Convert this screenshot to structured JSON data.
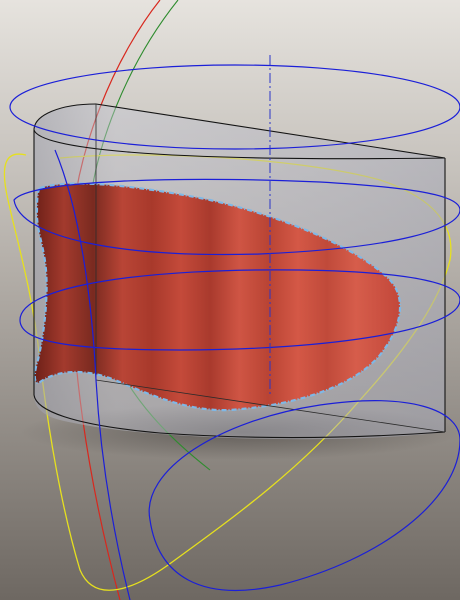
{
  "scene": {
    "background_top": "#e6e3de",
    "background_bottom": "#6e6862"
  },
  "colors": {
    "surface_fill": "#c9503f",
    "surface_dark": "#8f2f24",
    "surface_edge_outline": "#7fb8e6",
    "solid_edge": "#141414",
    "solid_fill": "#b9bcc8",
    "centerline": "#2a35c8",
    "curve_blue": "#1b1fd8",
    "curve_yellow": "#e6e01e",
    "curve_red": "#d8281e",
    "curve_green": "#2e8c2e"
  },
  "objects": [
    {
      "name": "half-cylinder-solid",
      "kind": "transparent solid"
    },
    {
      "name": "cut-surface",
      "kind": "curved surface"
    },
    {
      "name": "axis-centerline",
      "kind": "dash-dot line"
    },
    {
      "name": "blue-ellipse-curves",
      "kind": "construction curves"
    },
    {
      "name": "yellow-curve",
      "kind": "construction curve"
    },
    {
      "name": "red-curve",
      "kind": "construction curve"
    },
    {
      "name": "green-curve",
      "kind": "construction curve"
    }
  ]
}
